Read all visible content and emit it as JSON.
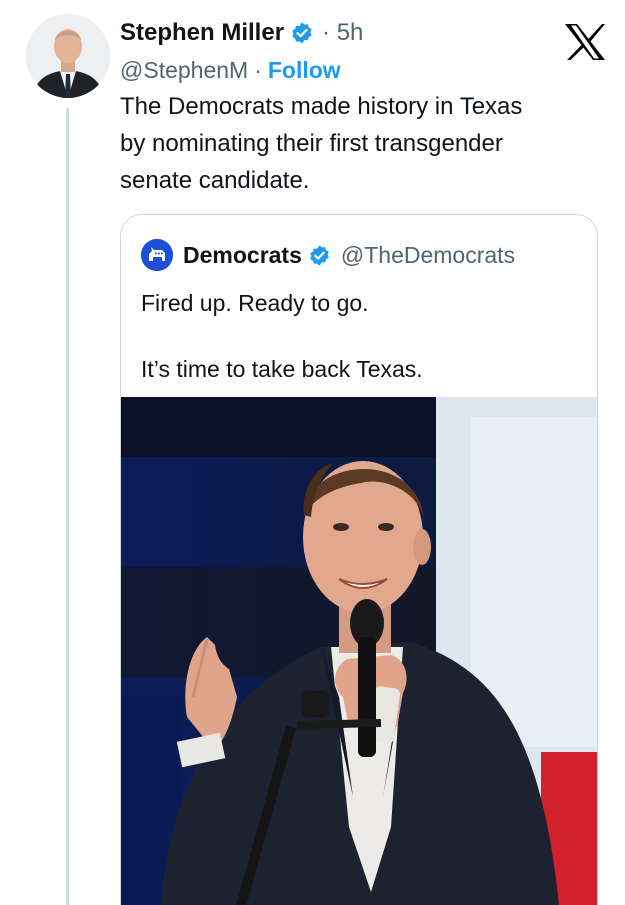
{
  "tweet": {
    "author": {
      "display_name": "Stephen Miller",
      "handle": "@StephenM",
      "verified": true
    },
    "time": "· 5h",
    "follow_label": "Follow",
    "handle_separator": "·",
    "text": "The Democrats made history in Texas\nby nominating their first transgender\nsenate candidate."
  },
  "quoted_tweet": {
    "author": {
      "display_name": "Democrats",
      "handle": "@TheDemocrats",
      "verified": true
    },
    "text": "Fired up. Ready to go.\n\nIt’s time to take back Texas."
  },
  "colors": {
    "accent": "#1d9bf0",
    "secondary_text": "#536471",
    "border": "#cfd9de"
  },
  "icons": {
    "verified": "verified-badge-icon",
    "platform": "x-logo-icon",
    "quoted_avatar": "donkey-logo-icon"
  }
}
